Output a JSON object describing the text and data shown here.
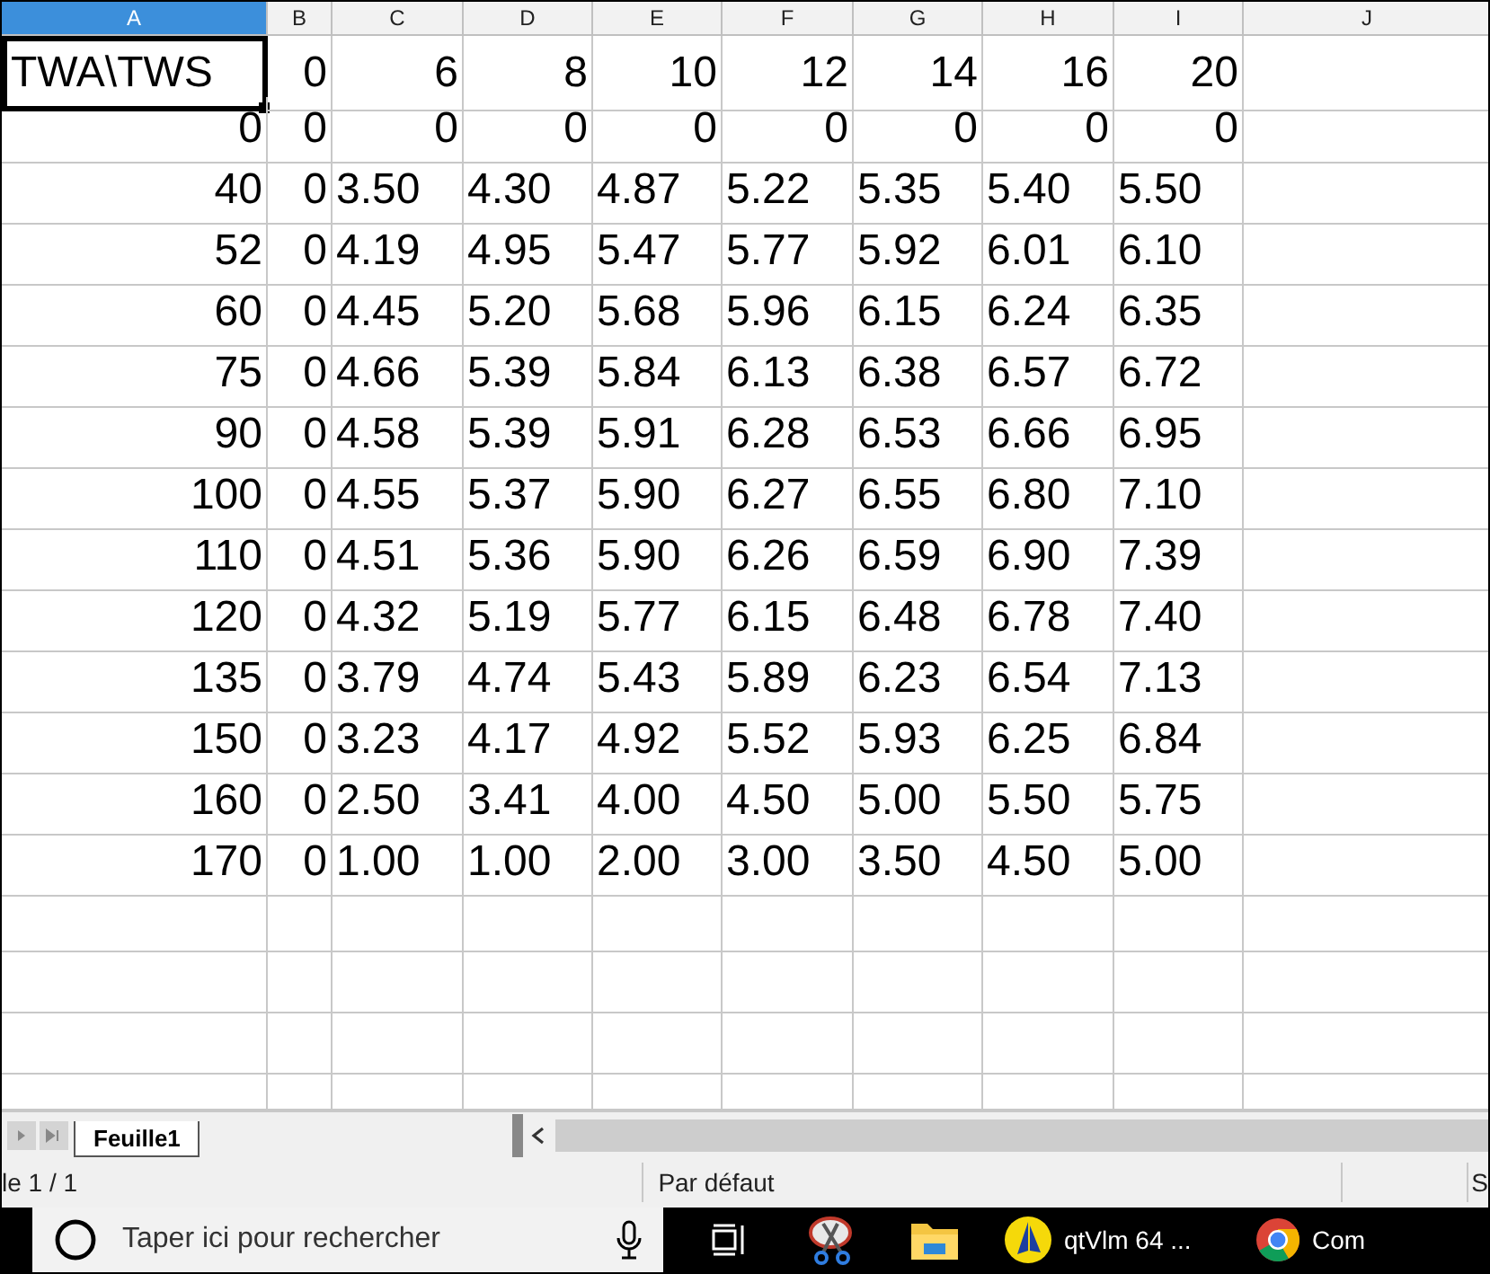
{
  "columns": [
    {
      "label": "A",
      "selected": true
    },
    {
      "label": "B",
      "selected": false
    },
    {
      "label": "C",
      "selected": false
    },
    {
      "label": "D",
      "selected": false
    },
    {
      "label": "E",
      "selected": false
    },
    {
      "label": "F",
      "selected": false
    },
    {
      "label": "G",
      "selected": false
    },
    {
      "label": "H",
      "selected": false
    },
    {
      "label": "I",
      "selected": false
    },
    {
      "label": "J",
      "selected": false
    }
  ],
  "rows": [
    {
      "kind": "header",
      "cells": [
        {
          "text": "TWA\\TWS",
          "selected": true
        },
        {
          "text": "0",
          "selected": false
        },
        {
          "text": "6",
          "selected": false
        },
        {
          "text": "8",
          "selected": false
        },
        {
          "text": "10",
          "selected": false
        },
        {
          "text": "12",
          "selected": false
        },
        {
          "text": "14",
          "selected": false
        },
        {
          "text": "16",
          "selected": false
        },
        {
          "text": "20",
          "selected": false
        }
      ]
    },
    {
      "kind": "numeric",
      "cells": [
        {
          "text": "0",
          "selected": false
        },
        {
          "text": "0",
          "selected": false
        },
        {
          "text": "0",
          "selected": false
        },
        {
          "text": "0",
          "selected": false
        },
        {
          "text": "0",
          "selected": false
        },
        {
          "text": "0",
          "selected": false
        },
        {
          "text": "0",
          "selected": false
        },
        {
          "text": "0",
          "selected": false
        },
        {
          "text": "0",
          "selected": false
        }
      ]
    },
    {
      "kind": "data",
      "cells": [
        {
          "text": "40",
          "selected": false
        },
        {
          "text": "0",
          "selected": false
        },
        {
          "text": "3.50",
          "selected": false
        },
        {
          "text": "4.30",
          "selected": false
        },
        {
          "text": "4.87",
          "selected": false
        },
        {
          "text": "5.22",
          "selected": false
        },
        {
          "text": "5.35",
          "selected": false
        },
        {
          "text": "5.40",
          "selected": false
        },
        {
          "text": "5.50",
          "selected": false
        }
      ]
    },
    {
      "kind": "data",
      "cells": [
        {
          "text": "52",
          "selected": false
        },
        {
          "text": "0",
          "selected": false
        },
        {
          "text": "4.19",
          "selected": false
        },
        {
          "text": "4.95",
          "selected": false
        },
        {
          "text": "5.47",
          "selected": false
        },
        {
          "text": "5.77",
          "selected": false
        },
        {
          "text": "5.92",
          "selected": false
        },
        {
          "text": "6.01",
          "selected": false
        },
        {
          "text": "6.10",
          "selected": false
        }
      ]
    },
    {
      "kind": "data",
      "cells": [
        {
          "text": "60",
          "selected": false
        },
        {
          "text": "0",
          "selected": false
        },
        {
          "text": "4.45",
          "selected": false
        },
        {
          "text": "5.20",
          "selected": false
        },
        {
          "text": "5.68",
          "selected": false
        },
        {
          "text": "5.96",
          "selected": false
        },
        {
          "text": "6.15",
          "selected": false
        },
        {
          "text": "6.24",
          "selected": false
        },
        {
          "text": "6.35",
          "selected": false
        }
      ]
    },
    {
      "kind": "data",
      "cells": [
        {
          "text": "75",
          "selected": false
        },
        {
          "text": "0",
          "selected": false
        },
        {
          "text": "4.66",
          "selected": false
        },
        {
          "text": "5.39",
          "selected": false
        },
        {
          "text": "5.84",
          "selected": false
        },
        {
          "text": "6.13",
          "selected": false
        },
        {
          "text": "6.38",
          "selected": false
        },
        {
          "text": "6.57",
          "selected": false
        },
        {
          "text": "6.72",
          "selected": false
        }
      ]
    },
    {
      "kind": "data",
      "cells": [
        {
          "text": "90",
          "selected": false
        },
        {
          "text": "0",
          "selected": false
        },
        {
          "text": "4.58",
          "selected": false
        },
        {
          "text": "5.39",
          "selected": false
        },
        {
          "text": "5.91",
          "selected": false
        },
        {
          "text": "6.28",
          "selected": false
        },
        {
          "text": "6.53",
          "selected": false
        },
        {
          "text": "6.66",
          "selected": false
        },
        {
          "text": "6.95",
          "selected": false
        }
      ]
    },
    {
      "kind": "data",
      "cells": [
        {
          "text": "100",
          "selected": false
        },
        {
          "text": "0",
          "selected": false
        },
        {
          "text": "4.55",
          "selected": false
        },
        {
          "text": "5.37",
          "selected": false
        },
        {
          "text": "5.90",
          "selected": false
        },
        {
          "text": "6.27",
          "selected": false
        },
        {
          "text": "6.55",
          "selected": false
        },
        {
          "text": "6.80",
          "selected": false
        },
        {
          "text": "7.10",
          "selected": false
        }
      ]
    },
    {
      "kind": "data",
      "cells": [
        {
          "text": "110",
          "selected": false
        },
        {
          "text": "0",
          "selected": false
        },
        {
          "text": "4.51",
          "selected": false
        },
        {
          "text": "5.36",
          "selected": false
        },
        {
          "text": "5.90",
          "selected": false
        },
        {
          "text": "6.26",
          "selected": false
        },
        {
          "text": "6.59",
          "selected": false
        },
        {
          "text": "6.90",
          "selected": false
        },
        {
          "text": "7.39",
          "selected": false
        }
      ]
    },
    {
      "kind": "data",
      "cells": [
        {
          "text": "120",
          "selected": false
        },
        {
          "text": "0",
          "selected": false
        },
        {
          "text": "4.32",
          "selected": false
        },
        {
          "text": "5.19",
          "selected": false
        },
        {
          "text": "5.77",
          "selected": false
        },
        {
          "text": "6.15",
          "selected": false
        },
        {
          "text": "6.48",
          "selected": false
        },
        {
          "text": "6.78",
          "selected": false
        },
        {
          "text": "7.40",
          "selected": false
        }
      ]
    },
    {
      "kind": "data",
      "cells": [
        {
          "text": "135",
          "selected": false
        },
        {
          "text": "0",
          "selected": false
        },
        {
          "text": "3.79",
          "selected": false
        },
        {
          "text": "4.74",
          "selected": false
        },
        {
          "text": "5.43",
          "selected": false
        },
        {
          "text": "5.89",
          "selected": false
        },
        {
          "text": "6.23",
          "selected": false
        },
        {
          "text": "6.54",
          "selected": false
        },
        {
          "text": "7.13",
          "selected": false
        }
      ]
    },
    {
      "kind": "data",
      "cells": [
        {
          "text": "150",
          "selected": false
        },
        {
          "text": "0",
          "selected": false
        },
        {
          "text": "3.23",
          "selected": false
        },
        {
          "text": "4.17",
          "selected": false
        },
        {
          "text": "4.92",
          "selected": false
        },
        {
          "text": "5.52",
          "selected": false
        },
        {
          "text": "5.93",
          "selected": false
        },
        {
          "text": "6.25",
          "selected": false
        },
        {
          "text": "6.84",
          "selected": false
        }
      ]
    },
    {
      "kind": "data",
      "cells": [
        {
          "text": "160",
          "selected": false
        },
        {
          "text": "0",
          "selected": false
        },
        {
          "text": "2.50",
          "selected": false
        },
        {
          "text": "3.41",
          "selected": false
        },
        {
          "text": "4.00",
          "selected": false
        },
        {
          "text": "4.50",
          "selected": false
        },
        {
          "text": "5.00",
          "selected": false
        },
        {
          "text": "5.50",
          "selected": false
        },
        {
          "text": "5.75",
          "selected": false
        }
      ]
    },
    {
      "kind": "data",
      "cells": [
        {
          "text": "170",
          "selected": false
        },
        {
          "text": "0",
          "selected": false
        },
        {
          "text": "1.00",
          "selected": false
        },
        {
          "text": "1.00",
          "selected": false
        },
        {
          "text": "2.00",
          "selected": false
        },
        {
          "text": "3.00",
          "selected": false
        },
        {
          "text": "3.50",
          "selected": false
        },
        {
          "text": "4.50",
          "selected": false
        },
        {
          "text": "5.00",
          "selected": false
        }
      ]
    }
  ],
  "sheet_tabs": [
    {
      "label": "Feuille1",
      "selected": true
    }
  ],
  "status_bar": {
    "page": "le 1 / 1",
    "style": "Par défaut",
    "cut": "S"
  },
  "taskbar": {
    "search": {
      "placeholder": "Taper ici pour rechercher"
    },
    "apps": [
      {
        "kind": "taskview"
      },
      {
        "kind": "scissors"
      },
      {
        "kind": "folder"
      },
      {
        "kind": "sail",
        "label": "qtVlm 64 ..."
      },
      {
        "kind": "browser",
        "label": "Com"
      }
    ]
  }
}
